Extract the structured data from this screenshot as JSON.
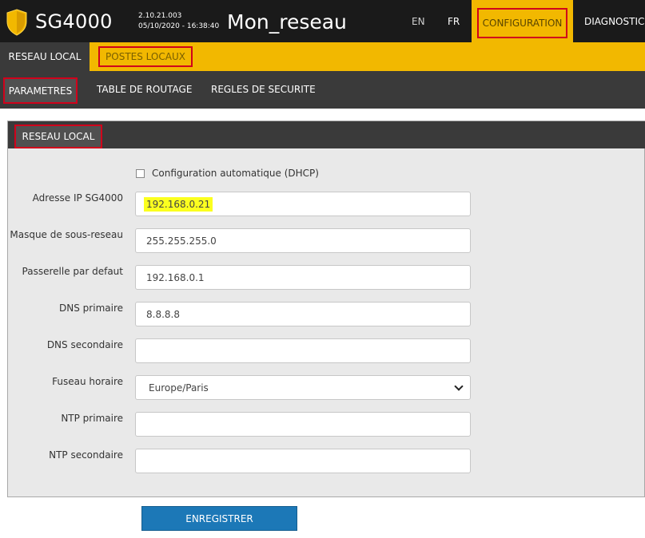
{
  "header": {
    "brand": "SG4000",
    "version": "2.10.21.003",
    "datetime": "05/10/2020 - 16:38:40",
    "device_name": "Mon_reseau",
    "lang_en": "EN",
    "lang_fr": "FR",
    "nav_configuration": "CONFIGURATION",
    "nav_diagnostic": "DIAGNOSTIC"
  },
  "tabs": {
    "reseau_local": "RESEAU LOCAL",
    "postes_locaux": "POSTES LOCAUX"
  },
  "subnav": {
    "parametres": "PARAMETRES",
    "table_routage": "TABLE DE ROUTAGE",
    "regles_securite": "REGLES DE SECURITE"
  },
  "panel": {
    "title": "RESEAU LOCAL",
    "dhcp_label": "Configuration automatique (DHCP)",
    "fields": [
      {
        "label": "Adresse IP SG4000",
        "value": "192.168.0.21"
      },
      {
        "label": "Masque de sous-reseau",
        "value": "255.255.255.0"
      },
      {
        "label": "Passerelle par defaut",
        "value": "192.168.0.1"
      },
      {
        "label": "DNS primaire",
        "value": "8.8.8.8"
      },
      {
        "label": "DNS secondaire",
        "value": ""
      },
      {
        "label": "Fuseau horaire",
        "value": "Europe/Paris"
      },
      {
        "label": "NTP primaire",
        "value": ""
      },
      {
        "label": "NTP secondaire",
        "value": ""
      }
    ]
  },
  "save_label": "ENREGISTRER",
  "colors": {
    "accent": "#f2b800",
    "header_bg": "#1a1a1a",
    "nav_bg": "#3a3a3a",
    "button": "#1c78b7",
    "highlight": "#d0021b"
  },
  "icons": {
    "logo": "shield-icon",
    "select": "chevron-down-icon"
  }
}
